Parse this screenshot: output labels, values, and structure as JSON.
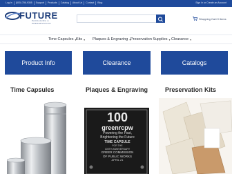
{
  "topbar": {
    "links": [
      "Log In",
      "(800) 786-9355",
      "Support",
      "Products",
      "Catalog",
      "About Us",
      "Contact",
      "Blog"
    ],
    "signin": "Sign In or Create an Account"
  },
  "logo": {
    "name": "FUTURE",
    "tagline": "PACKAGING & PRESERVATION"
  },
  "search": {
    "placeholder": ""
  },
  "cart": {
    "label": "Shopping Cart 0 items"
  },
  "nav": {
    "items": [
      {
        "label": "Time Capsules"
      },
      {
        "label": "Kits"
      },
      {
        "label": "Plaques & Engraving"
      },
      {
        "label": "Preservation Supplies"
      },
      {
        "label": "Clearance"
      }
    ]
  },
  "tiles": [
    {
      "label": "Product Info"
    },
    {
      "label": "Clearance"
    },
    {
      "label": "Catalogs"
    }
  ],
  "categories": [
    {
      "title": "Time Capsules"
    },
    {
      "title": "Plaques & Engraving"
    },
    {
      "title": "Preservation Kits"
    }
  ],
  "plaque": {
    "number": "100",
    "brand": "greenrcpw",
    "line1": "Powering the Past,",
    "line2": "Brightening the Future",
    "line3": "TIME CAPSULE",
    "line4": "FOR THE",
    "line5": "100TH ANNIVERSARY",
    "line6": "GREER COMMISSION",
    "line7": "OF PUBLIC WORKS",
    "line8": "APRIL 21"
  },
  "colors": {
    "brand_blue": "#1f4a9b",
    "plaque_black": "#1a1a1a"
  }
}
